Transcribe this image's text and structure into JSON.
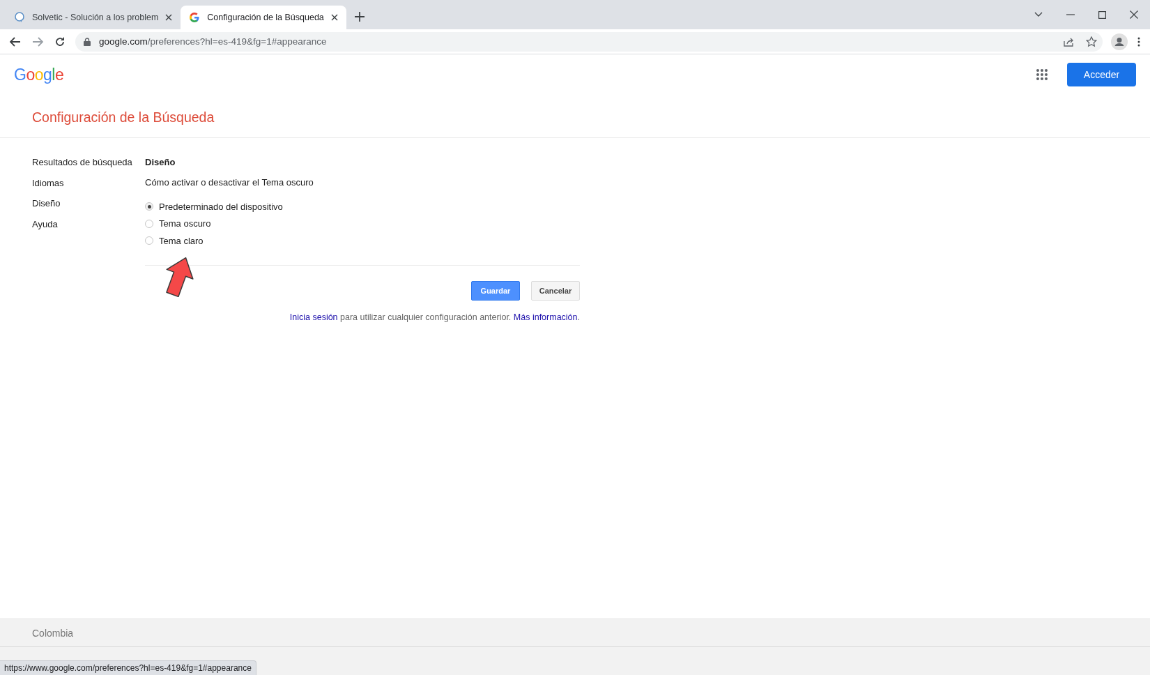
{
  "tabs": [
    {
      "title": "Solvetic - Solución a los problem",
      "selected": false
    },
    {
      "title": "Configuración de la Búsqueda",
      "selected": true
    }
  ],
  "address_bar": {
    "host": "google.com",
    "path": "/preferences?hl=es-419&fg=1#appearance"
  },
  "header": {
    "logo": "Google",
    "button": "Acceder"
  },
  "page_title": "Configuración de la Búsqueda",
  "sidebar": {
    "items": [
      {
        "label": "Resultados de búsqueda"
      },
      {
        "label": "Idiomas"
      },
      {
        "label": "Diseño"
      },
      {
        "label": "Ayuda"
      }
    ]
  },
  "section": {
    "heading": "Diseño",
    "description": "Cómo activar o desactivar el Tema oscuro",
    "options": [
      {
        "label": "Predeterminado del dispositivo",
        "selected": true
      },
      {
        "label": "Tema oscuro",
        "selected": false
      },
      {
        "label": "Tema claro",
        "selected": false
      }
    ]
  },
  "buttons": [
    {
      "label": "Guardar",
      "kind": "primary"
    },
    {
      "label": "Cancelar",
      "kind": "secondary"
    }
  ],
  "sign_in_note": [
    {
      "text": "Inicia sesión",
      "kind": "link"
    },
    {
      "text": " para utilizar cualquier configuración anterior. ",
      "kind": "text"
    },
    {
      "text": "Más información",
      "kind": "link"
    },
    {
      "text": ".",
      "kind": "text"
    }
  ],
  "footer": {
    "country": "Colombia"
  },
  "status_url": "https://www.google.com/preferences?hl=es-419&fg=1#appearance"
}
